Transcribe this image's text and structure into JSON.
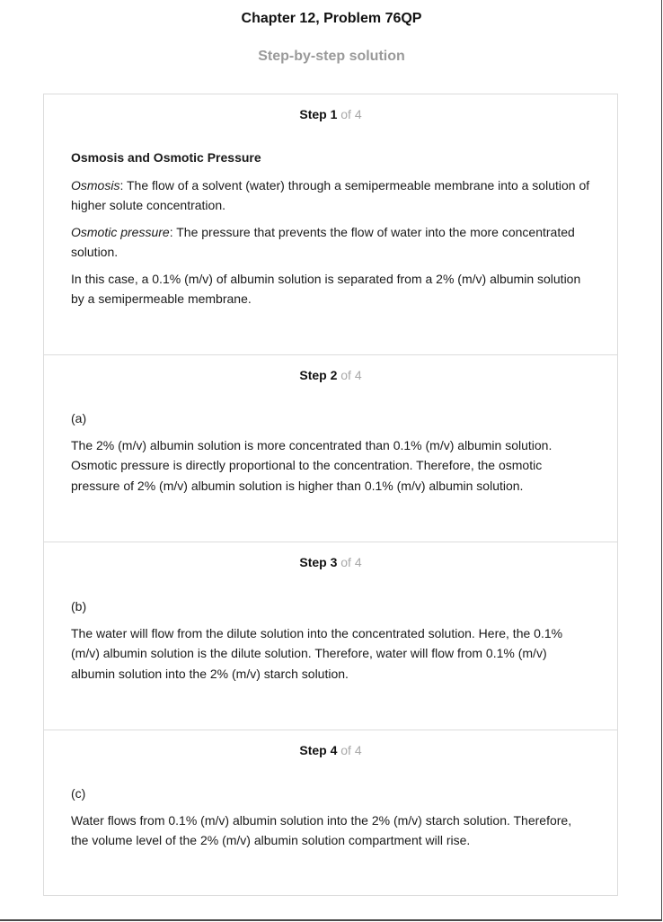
{
  "header": {
    "title": "Chapter 12, Problem 76QP",
    "subtitle": "Step-by-step solution"
  },
  "steps": [
    {
      "number": "Step 1",
      "total": "of 4",
      "heading": "Osmosis and Osmotic Pressure",
      "def1_term": "Osmosis",
      "def1_text": ": The flow of a solvent (water) through a semipermeable membrane into a solution of higher solute concentration.",
      "def2_term": "Osmotic pressure",
      "def2_text": ": The pressure that prevents the flow of water into the more concentrated solution.",
      "paragraph": "In this case, a 0.1% (m/v) of albumin solution is separated from a 2% (m/v) albumin solution by a semipermeable membrane."
    },
    {
      "number": "Step 2",
      "total": "of 4",
      "part": "(a)",
      "paragraph": "The 2% (m/v) albumin solution is more concentrated than 0.1% (m/v) albumin solution. Osmotic pressure is directly proportional to the concentration. Therefore, the osmotic pressure of 2% (m/v) albumin solution is higher than 0.1% (m/v) albumin solution."
    },
    {
      "number": "Step 3",
      "total": "of 4",
      "part": "(b)",
      "paragraph": "The water will flow from the dilute solution into the concentrated solution. Here, the 0.1% (m/v) albumin solution is the dilute solution. Therefore, water will flow from 0.1% (m/v) albumin solution into the 2% (m/v) starch solution."
    },
    {
      "number": "Step 4",
      "total": "of 4",
      "part": "(c)",
      "paragraph": "Water flows from 0.1% (m/v) albumin solution into the 2% (m/v) starch solution. Therefore, the volume level of the 2% (m/v) albumin solution compartment will rise."
    }
  ]
}
